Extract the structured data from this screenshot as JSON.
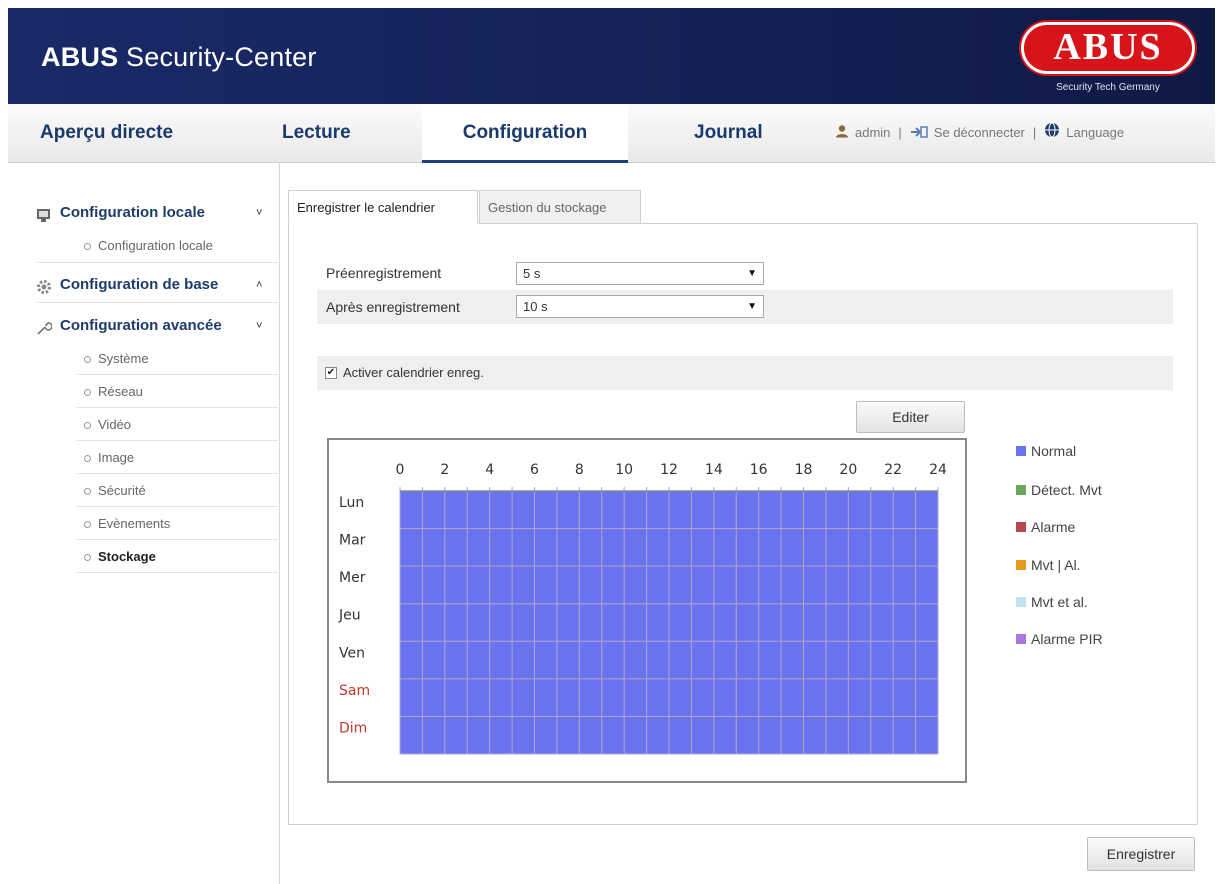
{
  "header": {
    "brand": "ABUS",
    "title_rest": " Security-Center",
    "logo_text": "ABUS",
    "logo_tagline": "Security Tech Germany"
  },
  "nav": {
    "tabs": [
      {
        "label": "Aperçu directe"
      },
      {
        "label": "Lecture"
      },
      {
        "label": "Configuration",
        "active": true
      },
      {
        "label": "Journal"
      }
    ],
    "user": "admin",
    "separator": "|",
    "logout": "Se déconnecter",
    "language": "Language"
  },
  "sidebar": {
    "sections": [
      {
        "label": "Configuration locale",
        "chevron": "˅",
        "icon": "monitor-icon"
      },
      {
        "label": "Configuration de base",
        "chevron": "˄",
        "icon": "gear-icon"
      },
      {
        "label": "Configuration avancée",
        "chevron": "˅",
        "icon": "wrench-icon"
      }
    ],
    "local_items": [
      "Configuration locale"
    ],
    "advanced_items": [
      "Système",
      "Réseau",
      "Vidéo",
      "Image",
      "Sécurité",
      "Evènements",
      "Stockage"
    ],
    "active_item": "Stockage"
  },
  "tabs": {
    "active": "Enregistrer le calendrier",
    "inactive": "Gestion du stockage"
  },
  "form": {
    "pre_record_label": "Préenregistrement",
    "pre_record_value": "5 s",
    "post_record_label": "Après enregistrement",
    "post_record_value": "10 s",
    "enable_label": "Activer calendrier enreg.",
    "enable_checked": true,
    "checkmark": "✔",
    "edit_button": "Editer",
    "save_button": "Enregistrer",
    "arrow": "▼"
  },
  "schedule": {
    "hours": [
      "0",
      "2",
      "4",
      "6",
      "8",
      "10",
      "12",
      "14",
      "16",
      "18",
      "20",
      "22",
      "24"
    ],
    "days": [
      "Lun",
      "Mar",
      "Mer",
      "Jeu",
      "Ven",
      "Sam",
      "Dim"
    ],
    "weekend_color": "#c0392b",
    "weekday_color": "#333333",
    "fill_type": "Normal",
    "fill_color": "#6b72f0",
    "grid_color": "#a9a9c8"
  },
  "legend": [
    {
      "label": "Normal",
      "color": "#6b72f0"
    },
    {
      "label": "Détect. Mvt",
      "color": "#69a85c"
    },
    {
      "label": "Alarme",
      "color": "#b5474f"
    },
    {
      "label": "Mvt | Al.",
      "color": "#e39a1a"
    },
    {
      "label": "Mvt et al.",
      "color": "#bfe4ef"
    },
    {
      "label": "Alarme PIR",
      "color": "#a878e0"
    }
  ],
  "colors": {
    "header_bg": "#16235a",
    "accent": "#1a3a6e",
    "logo_red": "#d7141a"
  }
}
